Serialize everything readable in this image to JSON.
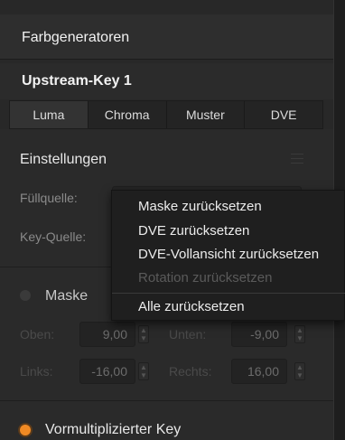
{
  "header": {
    "title": "Farbgeneratoren"
  },
  "subheader": {
    "title": "Upstream-Key 1"
  },
  "tabs": [
    {
      "label": "Luma",
      "active": true
    },
    {
      "label": "Chroma",
      "active": false
    },
    {
      "label": "Muster",
      "active": false
    },
    {
      "label": "DVE",
      "active": false
    }
  ],
  "settings": {
    "title": "Einstellungen",
    "menu_icon": "hamburger-icon",
    "fill_source_label": "Füllquelle:",
    "key_source_label": "Key-Quelle:"
  },
  "mask": {
    "label": "Maske",
    "top_label": "Oben:",
    "top_value": "9,00",
    "bottom_label": "Unten:",
    "bottom_value": "-9,00",
    "left_label": "Links:",
    "left_value": "-16,00",
    "right_label": "Rechts:",
    "right_value": "16,00"
  },
  "premultiplied": {
    "label": "Vormultiplizierter Key"
  },
  "context_menu": {
    "items": [
      {
        "label": "Maske zurücksetzen",
        "enabled": true
      },
      {
        "label": "DVE zurücksetzen",
        "enabled": true
      },
      {
        "label": "DVE-Vollansicht zurücksetzen",
        "enabled": true
      },
      {
        "label": "Rotation zurücksetzen",
        "enabled": false
      },
      {
        "label": "Alle zurücksetzen",
        "enabled": true
      }
    ]
  },
  "colors": {
    "background": "#282828",
    "accent_orange": "#f08a24",
    "menu_bg": "#1f1f1f"
  }
}
